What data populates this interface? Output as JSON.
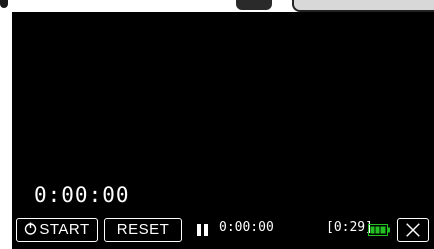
{
  "screen": {
    "elapsed_time": "0:00:00"
  },
  "controls": {
    "start_label": "START",
    "reset_label": "RESET",
    "close_label": "X"
  },
  "status": {
    "record_time": "0:00:00",
    "remaining_time": "[0:29]",
    "battery_icon": "battery-full-icon",
    "battery_color": "#22c022",
    "pause_icon": "pause-icon"
  },
  "colors": {
    "background": "#000000",
    "text": "#ffffff"
  }
}
